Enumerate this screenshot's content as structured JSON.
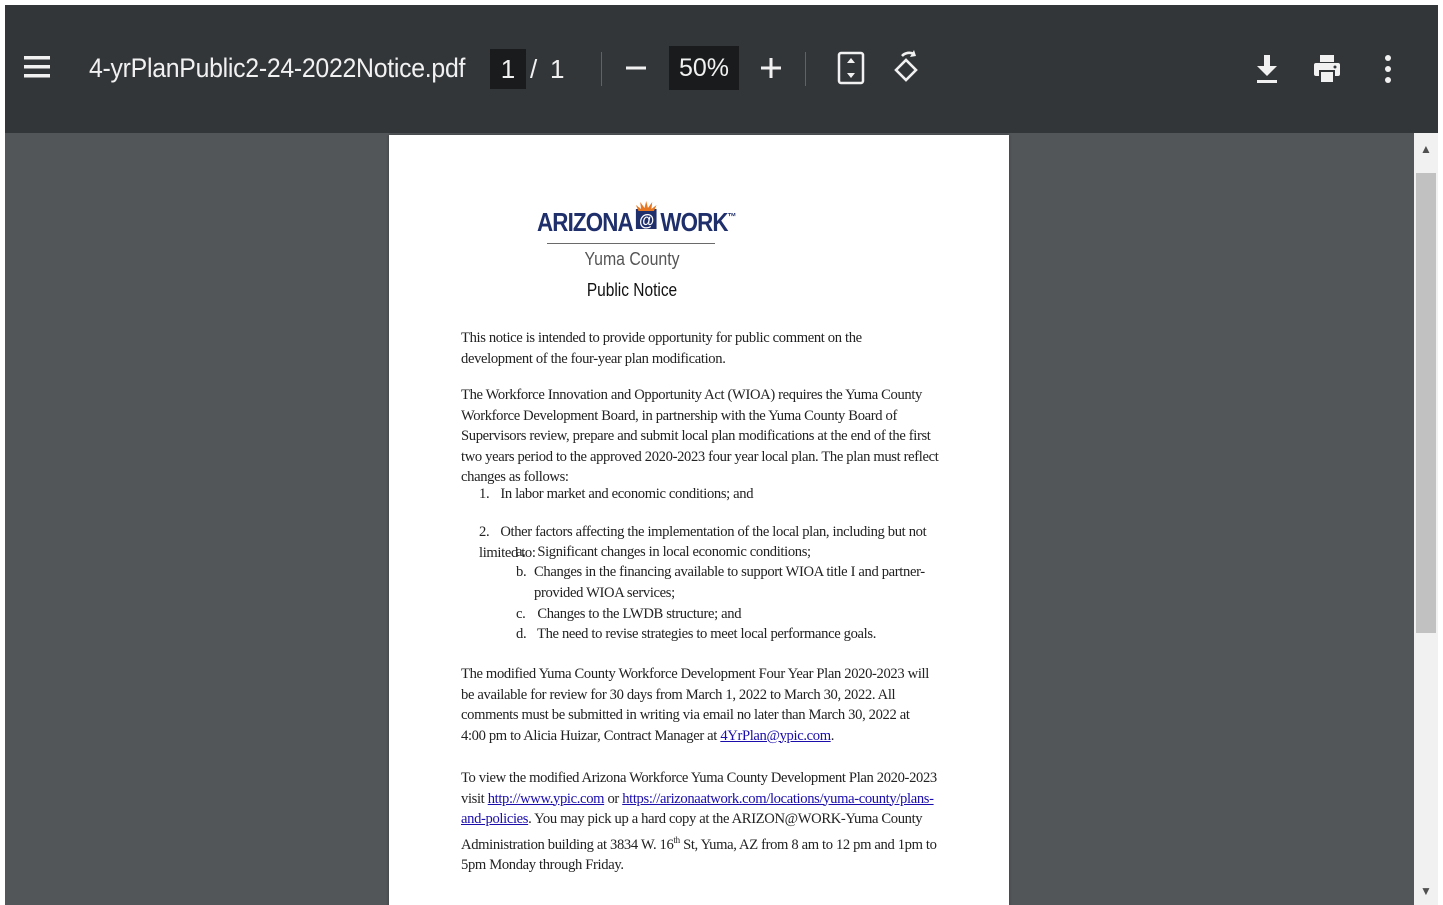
{
  "viewer": {
    "file_name": "4-yrPlanPublic2-24-2022Notice.pdf",
    "current_page": "1",
    "page_separator": "/",
    "total_pages": "1",
    "zoom": "50%",
    "zoom_out_symbol": "−",
    "zoom_in_symbol": "+",
    "icons": [
      "menu-icon",
      "zoom-out-icon",
      "zoom-in-icon",
      "fit-page-icon",
      "rotate-icon",
      "download-icon",
      "print-icon",
      "more-vert-icon"
    ]
  },
  "document": {
    "logo": {
      "left": "ARIZONA",
      "at": "@",
      "right": "WORK",
      "tm": "™"
    },
    "subtitle": "Yuma County",
    "heading": "Public Notice",
    "p1": "This notice is intended to provide opportunity for public comment on the development of the four-year plan modification.",
    "p2": "The Workforce Innovation and Opportunity Act (WIOA) requires the Yuma County Workforce Development Board, in partnership with the Yuma County Board of Supervisors review, prepare and submit local plan modifications at the end of the first two years period to the approved 2020-2023 four year local plan.  The plan must reflect changes as follows:",
    "list": [
      {
        "num": "1.",
        "text": "In labor market and economic conditions; and"
      },
      {
        "num": "2.",
        "text": "Other factors affecting the implementation of the local plan, including but not limited to:"
      }
    ],
    "sublist": [
      {
        "num": "a.",
        "text": "Significant changes in local economic conditions;"
      },
      {
        "num": "b.",
        "text": "Changes in the financing available to support WIOA title I and partner-provided WIOA services;"
      },
      {
        "num": "c.",
        "text": "Changes to the LWDB structure; and"
      },
      {
        "num": "d.",
        "text": "The need to revise strategies to meet local performance goals."
      }
    ],
    "p3_text": "The modified Yuma County Workforce Development Four Year Plan 2020-2023 will be available for review for 30 days from March 1, 2022 to March 30, 2022. All comments must be submitted in writing via email no later than March 30, 2022 at 4:00 pm to Alicia Huizar, Contract Manager at ",
    "p3_link": "4YrPlan@ypic.com",
    "p3_end": ".",
    "p4_text": "To view the modified Arizona Workforce Yuma County Development Plan 2020-2023 visit ",
    "p4_link1": "http://www.ypic.com",
    "p4_or": " or ",
    "p4_link2": "https://arizonaatwork.com/locations/yuma-county/plans-and-policies",
    "p4_rest": ". You may pick up a hard copy at the ARIZON@WORK-Yuma County Administration building at 3834 W. 16",
    "p4_sup": "th",
    "p4_end": " St, Yuma, AZ from 8 am to 12 pm and 1pm to 5pm Monday through Friday."
  },
  "scrollbar": {
    "up_arrow": "▲",
    "down_arrow": "▼"
  },
  "colors": {
    "toolbar": "#323639",
    "viewer_bg": "#525659",
    "logo_blue": "#1f2f6b",
    "logo_orange": "#e87722"
  }
}
